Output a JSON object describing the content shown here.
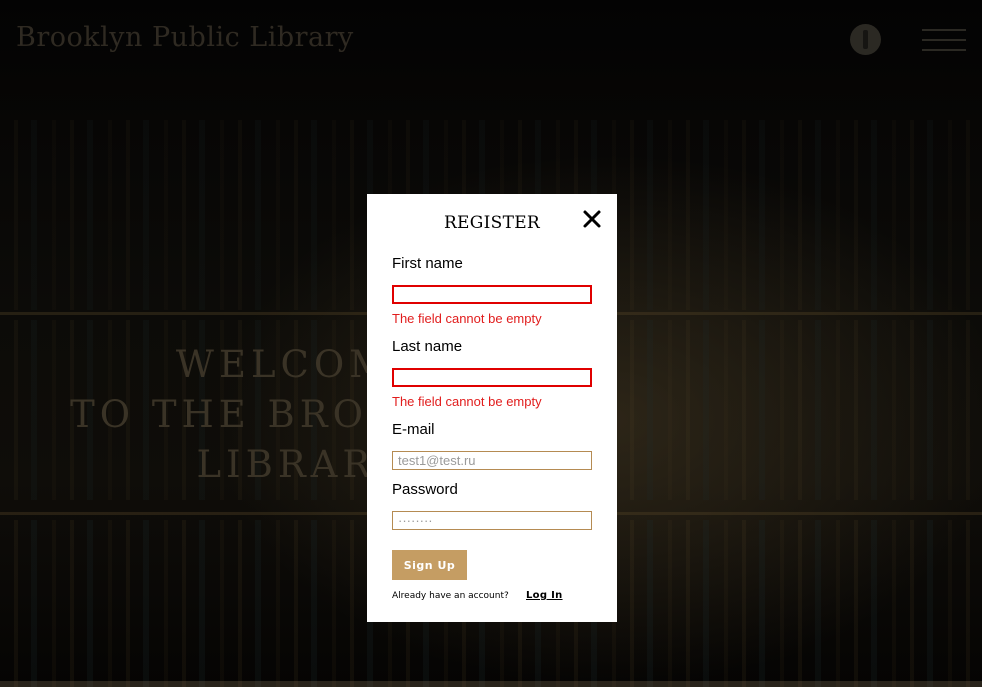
{
  "header": {
    "logo": "Brooklyn Public Library",
    "account_icon": "account-icon",
    "menu_icon": "burger-menu-icon"
  },
  "hero": {
    "line1": "WELCOME",
    "line2": "TO THE BROOKLYN",
    "line3": "LIBRARY"
  },
  "modal": {
    "title": "REGISTER",
    "close_icon": "close-icon",
    "first_name": {
      "label": "First name",
      "value": "",
      "error": "The field cannot be empty"
    },
    "last_name": {
      "label": "Last name",
      "value": "",
      "error": "The field cannot be empty"
    },
    "email": {
      "label": "E-mail",
      "value": "",
      "placeholder": "test1@test.ru"
    },
    "password": {
      "label": "Password",
      "value": "",
      "placeholder": "········"
    },
    "signup_label": "Sign Up",
    "account_prompt": "Already have an account?",
    "login_label": "Log In"
  },
  "colors": {
    "accent": "#c59d63",
    "input_border": "#b58b52",
    "error": "#e11d1d",
    "overlay": "#000000"
  }
}
